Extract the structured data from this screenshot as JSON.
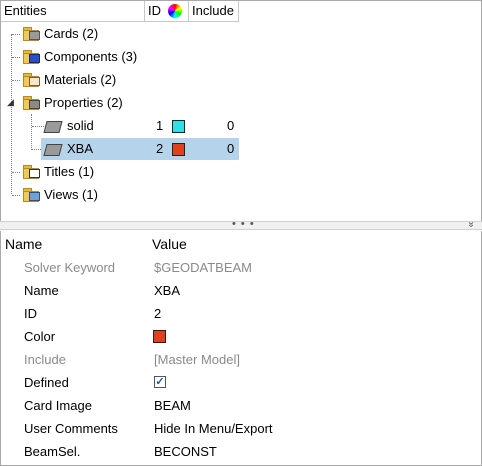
{
  "browser": {
    "headers": {
      "entities": "Entities",
      "id": "ID",
      "include": "Include"
    },
    "rows": [
      {
        "label": "Cards (2)"
      },
      {
        "label": "Components (3)"
      },
      {
        "label": "Materials (2)"
      },
      {
        "label": "Properties (2)"
      },
      {
        "label": "solid",
        "id": "1",
        "color": "#2ee0e8",
        "include": "0"
      },
      {
        "label": "XBA",
        "id": "2",
        "color": "#e0401c",
        "include": "0"
      },
      {
        "label": "Titles (1)"
      },
      {
        "label": "Views (1)"
      }
    ]
  },
  "splitter": {
    "dots": "• • •",
    "collapse": "»"
  },
  "properties": {
    "headers": {
      "name": "Name",
      "value": "Value"
    },
    "rows": [
      {
        "name": "Solver Keyword",
        "value": "$GEODATBEAM"
      },
      {
        "name": "Name",
        "value": "XBA"
      },
      {
        "name": "ID",
        "value": "2"
      },
      {
        "name": "Color",
        "color": "#e0401c"
      },
      {
        "name": "Include",
        "value": "[Master Model]"
      },
      {
        "name": "Defined",
        "checked": "✓"
      },
      {
        "name": "Card Image",
        "value": "BEAM"
      },
      {
        "name": "User Comments",
        "value": "Hide In Menu/Export"
      },
      {
        "name": "BeamSel.",
        "value": "BECONST"
      }
    ]
  }
}
